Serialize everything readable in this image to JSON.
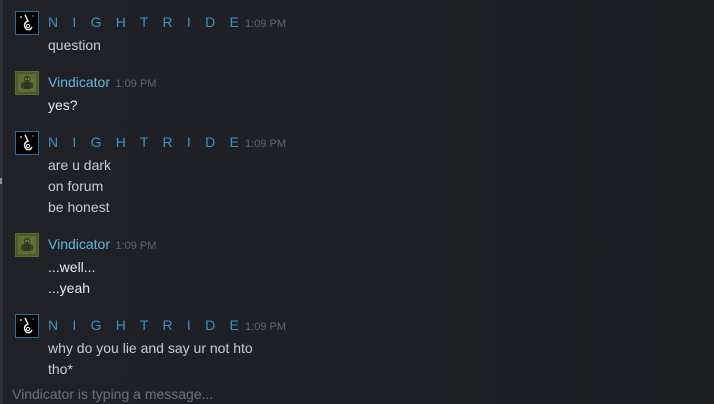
{
  "messages": [
    {
      "author": "N I G H T R I D E",
      "author_key": "nightride",
      "time": "1:09 PM",
      "lines": [
        "question"
      ]
    },
    {
      "author": "Vindicator",
      "author_key": "vindicator",
      "time": "1:09 PM",
      "lines": [
        "yes?"
      ]
    },
    {
      "author": "N I G H T R I D E",
      "author_key": "nightride",
      "time": "1:09 PM",
      "lines": [
        "are u dark",
        "on forum",
        "be honest"
      ]
    },
    {
      "author": "Vindicator",
      "author_key": "vindicator",
      "time": "1:09 PM",
      "lines": [
        "...well...",
        "...yeah"
      ]
    },
    {
      "author": "N I G H T R I D E",
      "author_key": "nightride",
      "time": "1:09 PM",
      "lines": [
        "why do you lie and say ur not hto",
        "tho*"
      ]
    }
  ],
  "typing_indicator": "Vindicator is typing a message...",
  "colors": {
    "background": "#1f2126",
    "nightride_name": "#3f91bf",
    "vindicator_name": "#62b8e4",
    "timestamp": "#5f646c",
    "message_text": "#c7ccd2"
  },
  "icons": {
    "nightride_avatar": "nightride-avatar-icon",
    "vindicator_avatar": "vindicator-avatar-icon"
  }
}
